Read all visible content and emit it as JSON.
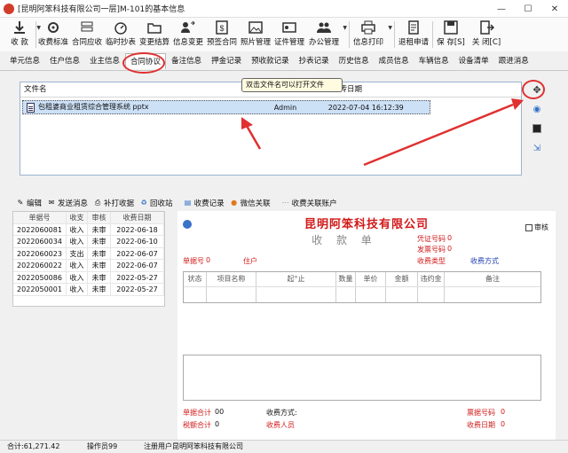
{
  "window": {
    "title": "[昆明阿笨科技有限公司一层]M-101的基本信息",
    "controls": [
      "—",
      "☐",
      "✕"
    ]
  },
  "toolbar": [
    {
      "label": "收 款",
      "icon": "download-icon",
      "dropdown": true
    },
    {
      "label": "收费标准",
      "icon": "gear-icon"
    },
    {
      "label": "合同应收",
      "icon": "stack-icon"
    },
    {
      "label": "临时抄表",
      "icon": "gauge-icon"
    },
    {
      "label": "变更结算",
      "icon": "folder-edit-icon"
    },
    {
      "label": "信息变更",
      "icon": "user-swap-icon"
    },
    {
      "label": "预签合同",
      "icon": "dollar-doc-icon"
    },
    {
      "label": "照片管理",
      "icon": "photo-icon"
    },
    {
      "label": "证件管理",
      "icon": "id-card-icon"
    },
    {
      "label": "办公管理",
      "icon": "people-icon",
      "dropdown": true
    },
    {
      "label": "信息打印",
      "icon": "printer-icon",
      "dropdown": true
    },
    {
      "label": "退租申请",
      "icon": "document-icon"
    },
    {
      "label": "保 存[S]",
      "icon": "save-icon"
    },
    {
      "label": "关 闭[C]",
      "icon": "exit-icon"
    }
  ],
  "tabs": [
    "单元信息",
    "住户信息",
    "业主信息",
    "合同协议",
    "备注信息",
    "押金记录",
    "预收款记录",
    "抄表记录",
    "历史信息",
    "成员信息",
    "车辆信息",
    "设备清单",
    "跟进消息"
  ],
  "active_tab": "合同协议",
  "files": {
    "headers": [
      "文件名",
      "上传人员",
      "上传日期"
    ],
    "rows": [
      {
        "name": "包租婆商业租赁综合管理系统 pptx",
        "uploader": "Admin",
        "date": "2022-07-04 16:12:39"
      }
    ],
    "tooltip": "双击文件名可以打开文件"
  },
  "side_buttons": [
    "add-icon",
    "refresh-icon",
    "save-icon",
    "export-icon"
  ],
  "actions": [
    "编辑",
    "发送消息",
    "补打收据",
    "回收站",
    "收费记录",
    "微信关联",
    "收费关联账户"
  ],
  "receipt_list": {
    "headers": [
      "单据号",
      "收支",
      "审核",
      "收费日期"
    ],
    "rows": [
      [
        "2022060081",
        "收入",
        "未审",
        "2022-06-18"
      ],
      [
        "2022060034",
        "收入",
        "未审",
        "2022-06-10"
      ],
      [
        "2022060023",
        "支出",
        "未审",
        "2022-06-07"
      ],
      [
        "2022060022",
        "收入",
        "未审",
        "2022-06-07"
      ],
      [
        "2022050086",
        "收入",
        "未审",
        "2022-05-27"
      ],
      [
        "2022050001",
        "收入",
        "未审",
        "2022-05-27"
      ]
    ]
  },
  "receipt": {
    "company": "昆明阿笨科技有限公司",
    "title": "收 款 单",
    "review_label": "审核",
    "voucher_label": "凭证号码",
    "voucher_value": "0",
    "invoice_label": "发票号码",
    "invoice_value": "0",
    "doc_no_label": "单据号",
    "doc_no_value": "0",
    "resident_label": "住户",
    "fee_type_label": "收费类型",
    "pay_method_label": "收费方式",
    "grid_headers": [
      "状态",
      "项目名称",
      "起°止",
      "数量",
      "单价",
      "金额",
      "违约金",
      "备注"
    ],
    "total_label": "单据合计",
    "total_value": "00",
    "pay_way_label": "收费方式:",
    "tax_label": "税额合计",
    "tax_value": "0",
    "collector_label": "收费人员",
    "ticket_label": "票据号码",
    "ticket_value": "0",
    "charge_date_label": "收费日期",
    "charge_date_value": "0"
  },
  "status": {
    "total": "合计:61,271.42",
    "operator": "操作员99",
    "registered": "注册用户昆明阿笨科技有限公司"
  },
  "colors": {
    "accent_red": "#d21919",
    "link_blue": "#1f3fb0",
    "highlight_red": "#e03030",
    "selected_row": "#cce0f6"
  }
}
